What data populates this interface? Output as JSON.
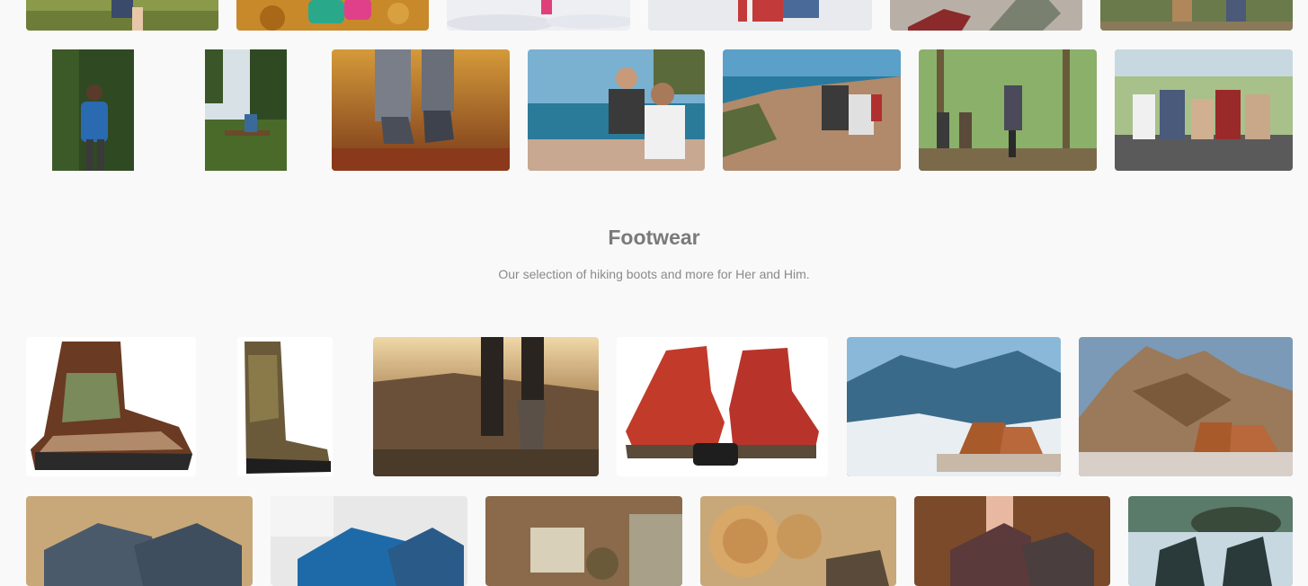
{
  "footwear_section": {
    "title": "Footwear",
    "subtitle": "Our selection of hiking boots and more for Her and Him."
  },
  "gallery_top": {
    "row1": [
      {
        "name": "gallery-photo-hiker-grass",
        "subject": "hiker in shorts on grass path"
      },
      {
        "name": "gallery-photo-autumn-kids",
        "subject": "children in autumn leaves"
      },
      {
        "name": "gallery-photo-snow",
        "subject": "person in snow"
      },
      {
        "name": "gallery-photo-winter-couple",
        "subject": "people in winter scarf"
      },
      {
        "name": "gallery-photo-boots-rest",
        "subject": "red boots resting"
      },
      {
        "name": "gallery-photo-hiking-pair",
        "subject": "two hikers walking"
      }
    ],
    "row2": [
      {
        "name": "gallery-photo-forest-backpacker",
        "subject": "hiker with blue backpack in forest"
      },
      {
        "name": "gallery-photo-bench-rest",
        "subject": "hiker sitting on bench"
      },
      {
        "name": "gallery-photo-autumn-boots",
        "subject": "walking boots on autumn leaves"
      },
      {
        "name": "gallery-photo-phone-couple",
        "subject": "couple looking at phone by sea"
      },
      {
        "name": "gallery-photo-cliff-couple",
        "subject": "couple sitting on cliff"
      },
      {
        "name": "gallery-photo-forest-group",
        "subject": "group hiking in forest"
      },
      {
        "name": "gallery-photo-friends-rest",
        "subject": "friends sitting together"
      }
    ]
  },
  "gallery_footwear": {
    "row1": [
      {
        "name": "footwear-photo-camo-boot",
        "subject": "camouflage hunting boot"
      },
      {
        "name": "footwear-photo-tall-camo-boot",
        "subject": "tall camouflage snake boot"
      },
      {
        "name": "footwear-photo-hiker-trail",
        "subject": "hiker legs on mountain trail"
      },
      {
        "name": "footwear-photo-red-boots",
        "subject": "red boots with binoculars"
      },
      {
        "name": "footwear-photo-boots-clouds",
        "subject": "boots above clouds"
      },
      {
        "name": "footwear-photo-boots-dolomites",
        "subject": "boots with rocky peaks"
      }
    ],
    "row2": [
      {
        "name": "footwear-photo-grey-boots",
        "subject": "grey boots blue laces"
      },
      {
        "name": "footwear-photo-blue-shoes",
        "subject": "blue hiking shoes"
      },
      {
        "name": "footwear-photo-map-gear",
        "subject": "map and gear on wood"
      },
      {
        "name": "footwear-photo-logs",
        "subject": "boots on logs"
      },
      {
        "name": "footwear-photo-pink-boots",
        "subject": "boots pink laces"
      },
      {
        "name": "footwear-photo-river-boots",
        "subject": "boots by river"
      }
    ]
  },
  "colors": {
    "background": "#f9f9f9",
    "title": "#7a7a7a",
    "subtitle": "#8a8a8a"
  }
}
